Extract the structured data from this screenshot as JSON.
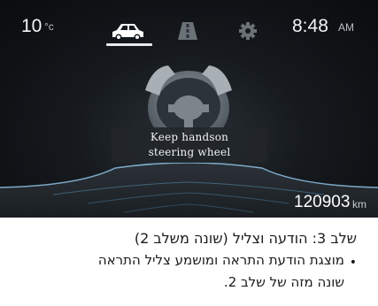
{
  "cluster": {
    "temperature": {
      "value": "10",
      "unit": "°c"
    },
    "clock": {
      "time": "8:48",
      "ampm": "AM"
    },
    "tabs": [
      {
        "id": "car",
        "icon": "car-icon",
        "active": true
      },
      {
        "id": "lane",
        "icon": "lane-icon",
        "active": false
      },
      {
        "id": "settings",
        "icon": "gear-icon",
        "active": false
      }
    ],
    "warning": {
      "icon": "hands-on-steering-wheel-icon",
      "line1": "Keep handson",
      "line2": "steering wheel"
    },
    "odometer": {
      "value": "120903",
      "unit": "km"
    },
    "colors": {
      "background": "#0a0c0e",
      "accent_blue": "#5fa8d6",
      "text": "#f4f4f4"
    }
  },
  "caption": {
    "title": "שלב 3: הודעה וצליל (שונה משלב 2)",
    "bullet": "•",
    "bullet_line1": "מוצגת הודעת התראה ומושמע צליל התראה",
    "bullet_line2": "שונה מזה של שלב 2."
  }
}
